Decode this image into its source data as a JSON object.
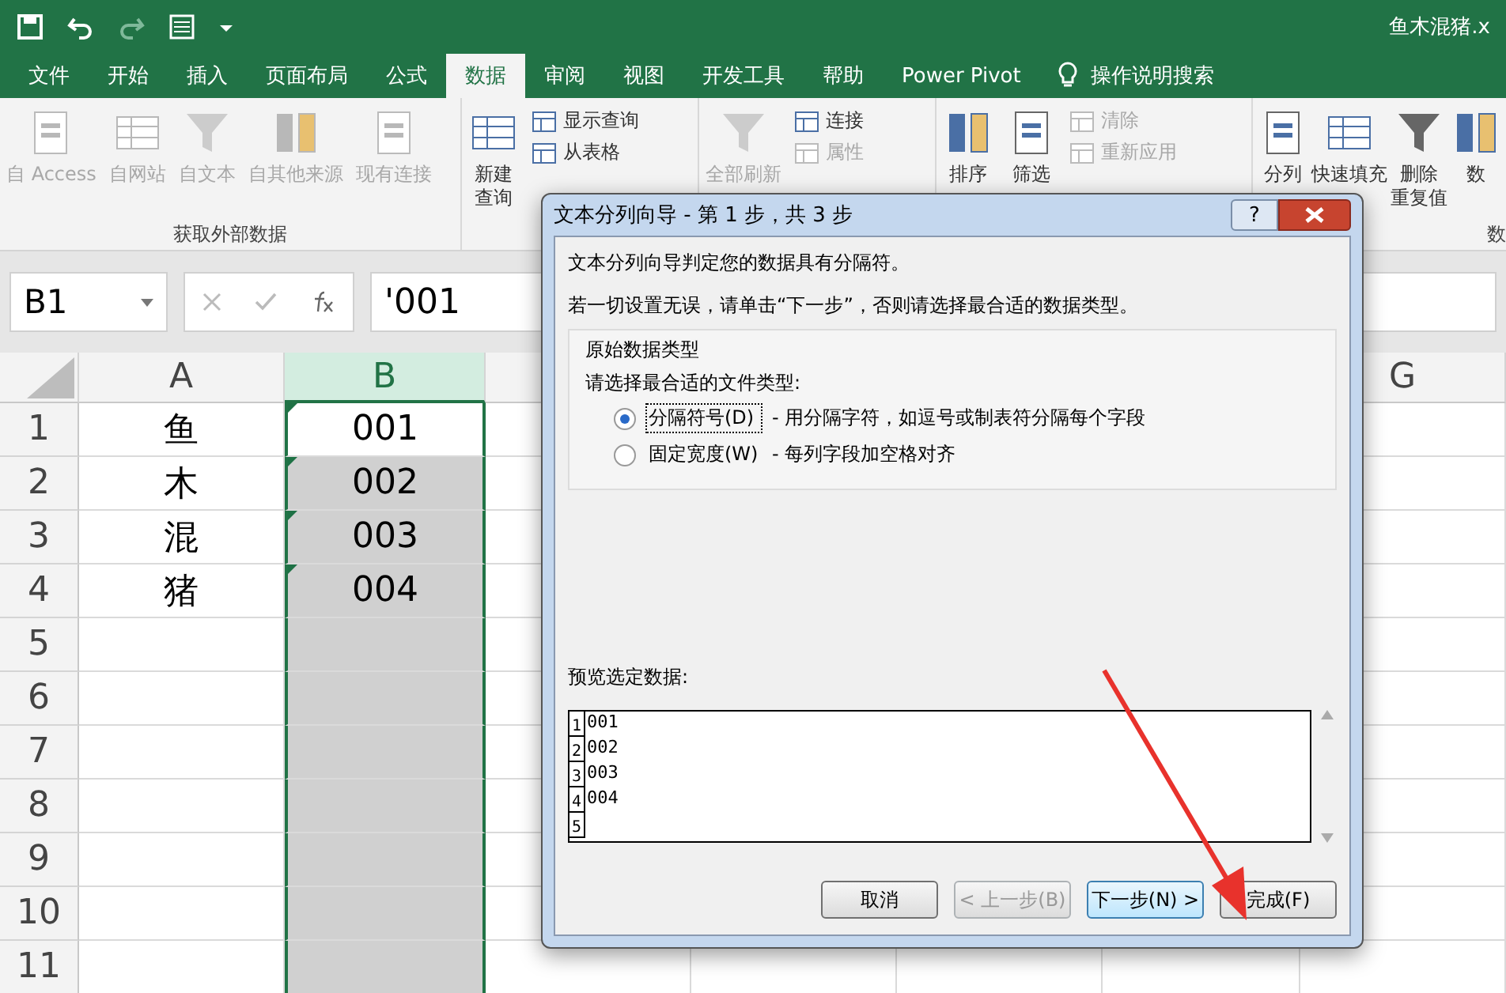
{
  "window": {
    "title": "鱼木混猪.x"
  },
  "tabs": [
    {
      "label": "文件",
      "selected": false
    },
    {
      "label": "开始",
      "selected": false
    },
    {
      "label": "插入",
      "selected": false
    },
    {
      "label": "页面布局",
      "selected": false
    },
    {
      "label": "公式",
      "selected": false
    },
    {
      "label": "数据",
      "selected": true
    },
    {
      "label": "审阅",
      "selected": false
    },
    {
      "label": "视图",
      "selected": false
    },
    {
      "label": "开发工具",
      "selected": false
    },
    {
      "label": "帮助",
      "selected": false
    },
    {
      "label": "Power Pivot",
      "selected": false
    }
  ],
  "tell_me": {
    "label": "操作说明搜索"
  },
  "ribbon_groups": [
    {
      "label": "获取外部数据",
      "large": [
        {
          "lines": [
            "自 Access"
          ],
          "disabled": true
        },
        {
          "lines": [
            "自网站"
          ],
          "disabled": true
        },
        {
          "lines": [
            "自文本"
          ],
          "disabled": true
        },
        {
          "lines": [
            "自其他来源"
          ],
          "disabled": true
        },
        {
          "lines": [
            "现有连接"
          ],
          "disabled": true
        }
      ]
    },
    {
      "large": [
        {
          "lines": [
            "新建",
            "查询"
          ],
          "disabled": false
        }
      ],
      "small": [
        {
          "label": "显示查询",
          "disabled": false
        },
        {
          "label": "从表格",
          "disabled": false
        }
      ]
    },
    {
      "large": [
        {
          "lines": [
            "全部刷新"
          ],
          "disabled": true
        }
      ],
      "small": [
        {
          "label": "连接",
          "disabled": false
        },
        {
          "label": "属性",
          "disabled": true
        }
      ]
    },
    {
      "large": [
        {
          "lines": [
            "排序"
          ],
          "disabled": false
        },
        {
          "lines": [
            "筛选"
          ],
          "disabled": false
        }
      ],
      "small": [
        {
          "label": "清除",
          "disabled": true
        },
        {
          "label": "重新应用",
          "disabled": true
        }
      ]
    },
    {
      "label": "数",
      "large": [
        {
          "lines": [
            "分列"
          ],
          "disabled": false
        },
        {
          "lines": [
            "快速填充"
          ],
          "disabled": false
        },
        {
          "lines": [
            "删除",
            "重复值"
          ],
          "disabled": false
        },
        {
          "lines": [
            "数"
          ],
          "disabled": false
        }
      ]
    }
  ],
  "formula_bar": {
    "name_box": "B1",
    "formula": "'001"
  },
  "columns": [
    {
      "label": "A",
      "selected": false
    },
    {
      "label": "B",
      "selected": true
    },
    {
      "label": "G",
      "selected": false
    }
  ],
  "rows": [
    {
      "number": "1",
      "a": "鱼",
      "b": "001",
      "flag": true
    },
    {
      "number": "2",
      "a": "木",
      "b": "002",
      "flag": true
    },
    {
      "number": "3",
      "a": "混",
      "b": "003",
      "flag": true
    },
    {
      "number": "4",
      "a": "猪",
      "b": "004",
      "flag": true
    },
    {
      "number": "5",
      "a": "",
      "b": "",
      "flag": false
    },
    {
      "number": "6",
      "a": "",
      "b": "",
      "flag": false
    },
    {
      "number": "7",
      "a": "",
      "b": "",
      "flag": false
    },
    {
      "number": "8",
      "a": "",
      "b": "",
      "flag": false
    },
    {
      "number": "9",
      "a": "",
      "b": "",
      "flag": false
    },
    {
      "number": "10",
      "a": "",
      "b": "",
      "flag": false
    },
    {
      "number": "11",
      "a": "",
      "b": "",
      "flag": false
    }
  ],
  "dialog": {
    "title": "文本分列向导 - 第 1 步，共 3 步",
    "help": "?",
    "intro": "文本分列向导判定您的数据具有分隔符。",
    "hint": "若一切设置无误，请单击“下一步”，否则请选择最合适的数据类型。",
    "group_title": "原始数据类型",
    "prompt": "请选择最合适的文件类型:",
    "options": [
      {
        "label": "分隔符号(D)",
        "description": "- 用分隔字符，如逗号或制表符分隔每个字段",
        "selected": true
      },
      {
        "label": "固定宽度(W)",
        "description": "- 每列字段加空格对齐",
        "selected": false
      }
    ],
    "preview_label": "预览选定数据:",
    "preview_rows": [
      {
        "number": "1",
        "text": "001"
      },
      {
        "number": "2",
        "text": "002"
      },
      {
        "number": "3",
        "text": "003"
      },
      {
        "number": "4",
        "text": "004"
      },
      {
        "number": "5",
        "text": ""
      }
    ],
    "buttons": [
      {
        "label": "取消",
        "disabled": false
      },
      {
        "label": "< 上一步(B)",
        "disabled": true
      },
      {
        "label": "下一步(N) >",
        "disabled": false
      },
      {
        "label": "完成(F)",
        "disabled": false
      }
    ]
  }
}
